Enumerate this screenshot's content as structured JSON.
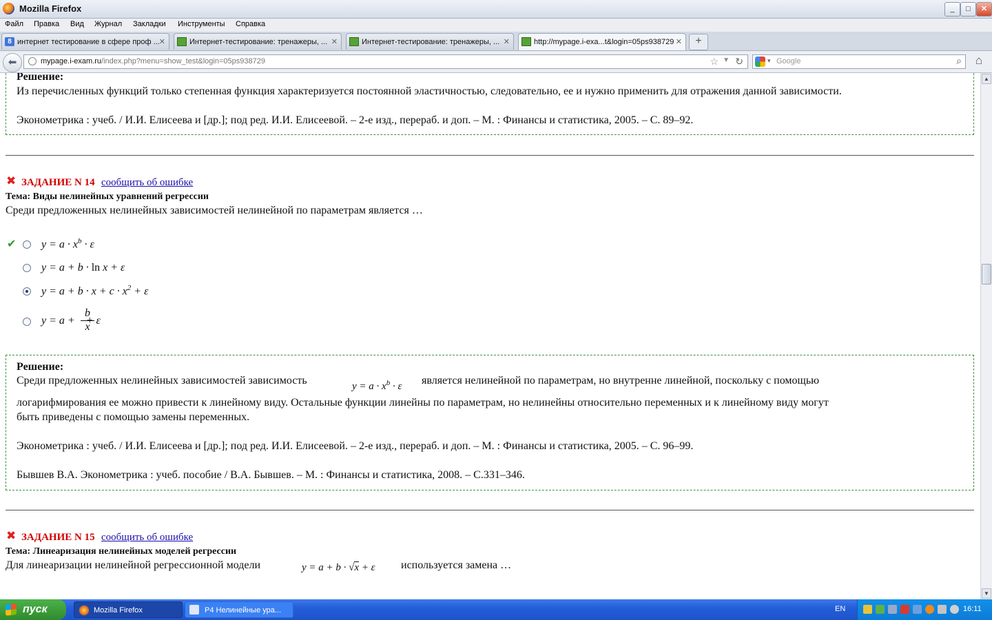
{
  "window": {
    "title": "Mozilla Firefox",
    "min_label": "_",
    "max_label": "□",
    "close_label": "✕"
  },
  "menu": [
    "Файл",
    "Правка",
    "Вид",
    "Журнал",
    "Закладки",
    "Инструменты",
    "Справка"
  ],
  "tabs": [
    {
      "label": "интернет тестирование в сфере проф ...",
      "icon": "google-icon",
      "active": false
    },
    {
      "label": "Интернет-тестирование: тренажеры, ...",
      "icon": "envelope-icon",
      "active": false
    },
    {
      "label": "Интернет-тестирование: тренажеры, ...",
      "icon": "envelope-icon",
      "active": false
    },
    {
      "label": "http://mypage.i-exa...t&login=05ps938729",
      "icon": "envelope-icon",
      "active": true
    }
  ],
  "new_tab_label": "+",
  "nav": {
    "url_host": "mypage.i-exam.ru",
    "url_path": "/index.php?menu=show_test&login=05ps938729",
    "search_placeholder": "Google"
  },
  "page": {
    "sol13": {
      "heading": "Решение:",
      "text": "Из перечисленных функций только степенная функция характеризуется постоянной эластичностью, следовательно, ее и нужно применить для отражения данной зависимости.",
      "ref": "Эконометрика : учеб. / И.И. Елисеева и [др.]; под ред. И.И. Елисеевой. – 2-е изд., перераб. и доп. – М. : Финансы и статистика, 2005. – С. 89–92."
    },
    "task14": {
      "title": "ЗАДАНИЕ N 14",
      "report_link": "сообщить об ошибке",
      "topic": "Тема: Виды нелинейных уравнений регрессии",
      "question": "Среди предложенных нелинейных зависимостей нелинейной по параметрам является …",
      "options": [
        {
          "formula": "y = a·x^b·ε",
          "correct": true,
          "selected": false
        },
        {
          "formula": "y = a + b·ln x + ε",
          "correct": false,
          "selected": false
        },
        {
          "formula": "y = a + b·x + c·x^2 + ε",
          "correct": false,
          "selected": true
        },
        {
          "formula": "y = a + b/x + ε",
          "correct": false,
          "selected": false
        }
      ],
      "solution": {
        "heading": "Решение:",
        "text1": "Среди предложенных нелинейных зависимостей зависимость",
        "text1b": "является нелинейной по параметрам, но внутренне линейной, поскольку с помощью",
        "text2": "логарифмирования ее можно привести к линейному виду. Остальные функции линейны по параметрам, но нелинейны относительно переменных и к линейному виду могут",
        "text3": "быть приведены с помощью замены переменных.",
        "ref1": "Эконометрика : учеб. / И.И. Елисеева и [др.]; под ред. И.И. Елисеевой. – 2-е изд., перераб. и доп. – М. : Финансы и статистика, 2005. – С. 96–99.",
        "ref2": "Бывшев В.А. Эконометрика : учеб. пособие / В.А. Бывшев. – М. : Финансы и статистика, 2008. – С.331–346."
      }
    },
    "task15": {
      "title": "ЗАДАНИЕ N 15",
      "report_link": "сообщить об ошибке",
      "topic": "Тема: Линеаризация нелинейных моделей регрессии",
      "question_a": "Для линеаризации нелинейной регрессионной модели",
      "question_b": "используется замена …"
    }
  },
  "taskbar": {
    "start_label": "пуск",
    "buttons": [
      {
        "label": "Mozilla Firefox",
        "active": true
      },
      {
        "label": "Р4 Нелинейные ура...",
        "active": false
      }
    ],
    "lang": "EN",
    "clock": "16:11"
  },
  "colors": {
    "task_title": "#d00000",
    "link": "#1a0dab",
    "solution_border": "#3f8f3f",
    "correct_check": "#2e9a2e",
    "wrong_x": "#e02020"
  }
}
